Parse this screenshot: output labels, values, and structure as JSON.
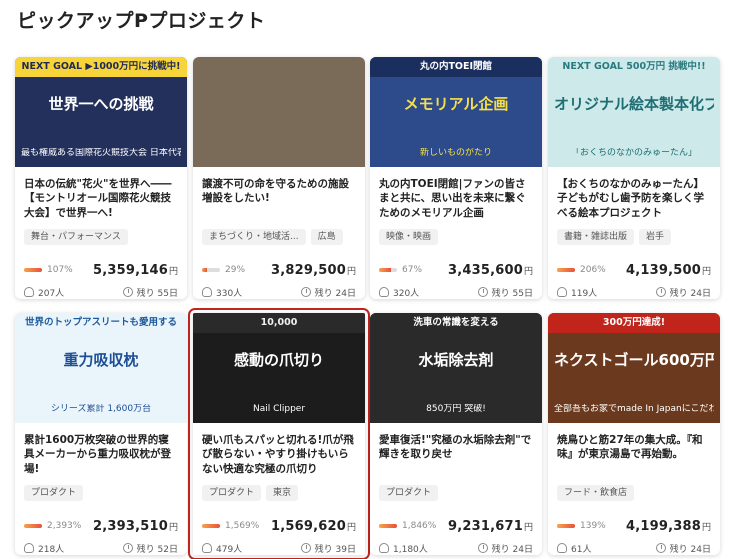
{
  "page_title": "ピックアップPプロジェクト",
  "projects": [
    {
      "thumb": {
        "badge": "NEXT GOAL ▶1000万円に挑戦中!",
        "text": "世界一への挑戦",
        "sub": "最も権威ある国際花火競技大会 日本代表に選出!!",
        "bg": "#23305c",
        "badge_bg": "#f7d43a",
        "badge_color": "#1f2a55",
        "text_color": "#ffffff"
      },
      "title": "日本の伝統\"花火\"を世界へ――【モントリオール国際花火競技大会】で世界一へ!",
      "tags": [
        "舞台・パフォーマンス"
      ],
      "percent": "107%",
      "percent_value": 107,
      "amount": "5,359,146",
      "yen": "円",
      "supporters": "207人",
      "remaining": "残り 55日"
    },
    {
      "thumb": {
        "badge": "",
        "text": "",
        "sub": "",
        "bg": "#7a6a58",
        "badge_bg": "",
        "badge_color": "",
        "text_color": "#ffffff"
      },
      "title": "譲渡不可の命を守るための施設増設をしたい!",
      "tags": [
        "まちづくり・地域活...",
        "広島"
      ],
      "percent": "29%",
      "percent_value": 29,
      "amount": "3,829,500",
      "yen": "円",
      "supporters": "330人",
      "remaining": "残り 24日"
    },
    {
      "thumb": {
        "badge": "丸の内TOEI閉館",
        "text": "メモリアル企画",
        "sub": "新しいものがたり",
        "bg": "#2d4a8a",
        "badge_bg": "#1b2f5e",
        "badge_color": "#ffffff",
        "text_color": "#f4e04d"
      },
      "title": "丸の内TOEI閉館|ファンの皆さまと共に、思い出を未来に繋ぐためのメモリアル企画",
      "tags": [
        "映像・映画"
      ],
      "percent": "67%",
      "percent_value": 67,
      "amount": "3,435,600",
      "yen": "円",
      "supporters": "320人",
      "remaining": "残り 55日"
    },
    {
      "thumb": {
        "badge": "NEXT GOAL 500万円 挑戦中!!",
        "text": "オリジナル絵本製本化プロジェクト",
        "sub": "「おくちのなかのみゅーたん」",
        "bg": "#cde9ea",
        "badge_bg": "#cde9ea",
        "badge_color": "#2a7a7f",
        "text_color": "#1f6e74"
      },
      "title": "【おくちのなかのみゅーたん】子どもがむし歯予防を楽しく学べる絵本プロジェクト",
      "tags": [
        "書籍・雑誌出版",
        "岩手"
      ],
      "percent": "206%",
      "percent_value": 100,
      "amount": "4,139,500",
      "yen": "円",
      "supporters": "119人",
      "remaining": "残り 24日"
    },
    {
      "thumb": {
        "badge": "世界のトップアスリートも愛用する",
        "text": "重力吸収枕",
        "sub": "シリーズ累計 1,600万台",
        "bg": "#eaf4fb",
        "badge_bg": "#eaf4fb",
        "badge_color": "#1d5a9c",
        "text_color": "#1d4f96"
      },
      "title": "累計1600万枚突破の世界的寝具メーカーから重力吸収枕が登場!",
      "tags": [
        "プロダクト"
      ],
      "percent": "2,393%",
      "percent_value": 100,
      "amount": "2,393,510",
      "yen": "円",
      "supporters": "218人",
      "remaining": "残り 52日"
    },
    {
      "thumb": {
        "badge": "10,000",
        "text": "感動の爪切り",
        "sub": "Nail Clipper",
        "bg": "#1c1c1c",
        "badge_bg": "#2a2a2a",
        "badge_color": "#f0f0f0",
        "text_color": "#ffffff"
      },
      "title": "硬い爪もスパッと切れる!爪が飛び散らない・やすり掛けもいらない快適な究極の爪切り",
      "tags": [
        "プロダクト",
        "東京"
      ],
      "percent": "1,569%",
      "percent_value": 100,
      "amount": "1,569,620",
      "yen": "円",
      "supporters": "479人",
      "remaining": "残り 39日",
      "selected": true
    },
    {
      "thumb": {
        "badge": "洗車の常識を変える",
        "text": "水垢除去剤",
        "sub": "850万円 突破!",
        "bg": "#2a2a2a",
        "badge_bg": "#2a2a2a",
        "badge_color": "#ffffff",
        "text_color": "#ffffff"
      },
      "title": "愛車復活!\"究極の水垢除去剤\"で輝きを取り戻せ",
      "tags": [
        "プロダクト"
      ],
      "percent": "1,846%",
      "percent_value": 100,
      "amount": "9,231,671",
      "yen": "円",
      "supporters": "1,180人",
      "remaining": "残り 24日"
    },
    {
      "thumb": {
        "badge": "300万円達成!",
        "text": "ネクストゴール600万円に挑戦中",
        "sub": "全部吾もお家でmade In Japanにこだわった",
        "bg": "#6b3a1e",
        "badge_bg": "#c0241b",
        "badge_color": "#ffffff",
        "text_color": "#ffffff"
      },
      "title": "焼鳥ひと筋27年の集大成。『和味』が東京湯島で再始動。",
      "tags": [
        "フード・飲食店"
      ],
      "percent": "139%",
      "percent_value": 100,
      "amount": "4,199,388",
      "yen": "円",
      "supporters": "61人",
      "remaining": "残り 24日"
    }
  ]
}
